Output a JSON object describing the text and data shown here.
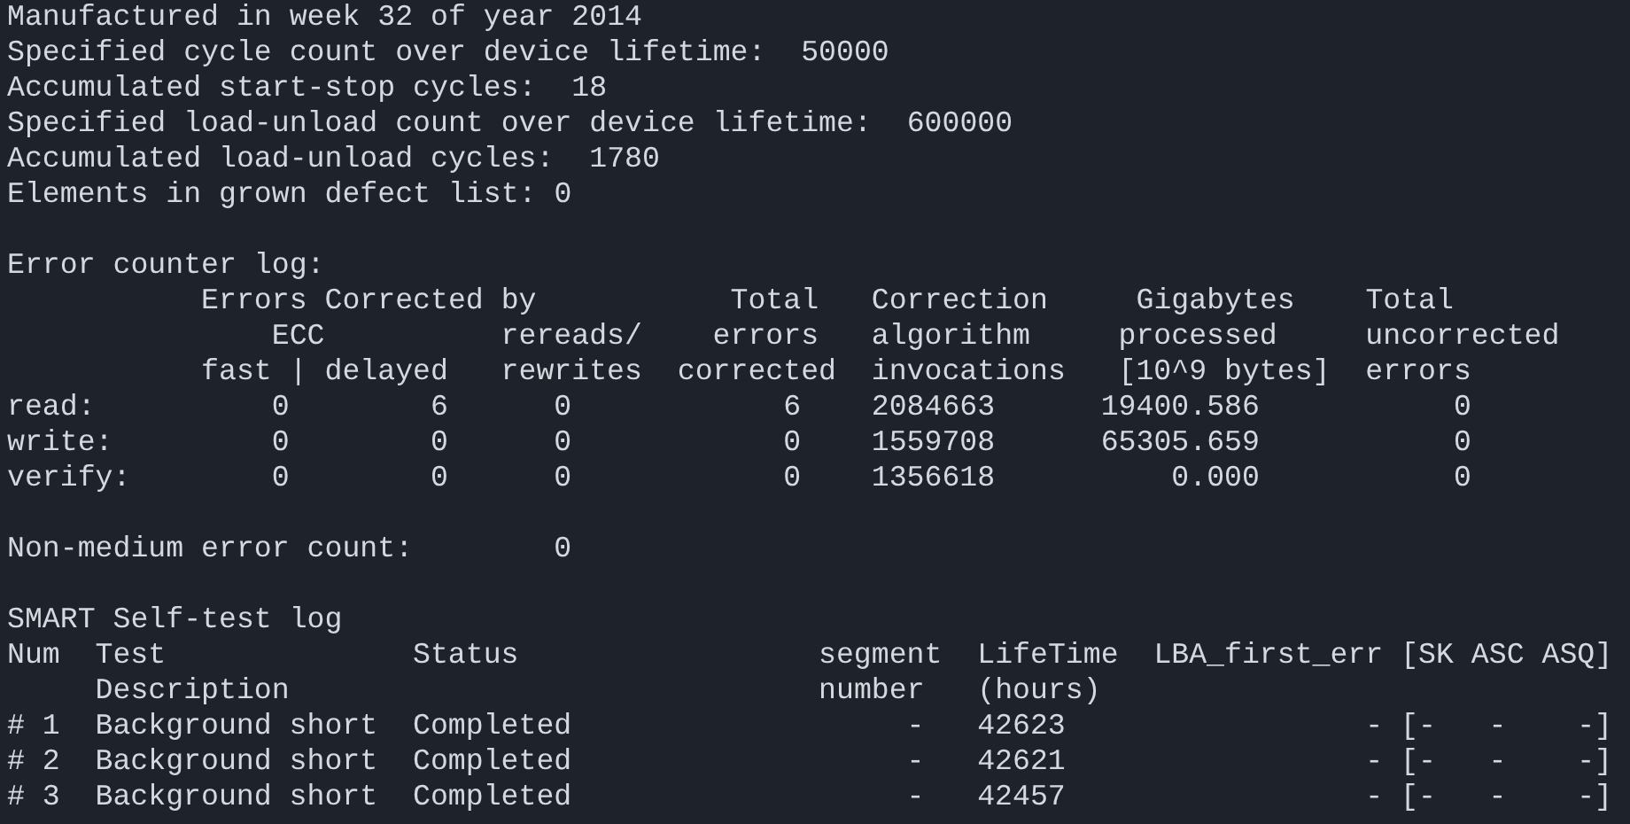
{
  "info_lines": [
    "Manufactured in week 32 of year 2014",
    "Specified cycle count over device lifetime:  50000",
    "Accumulated start-stop cycles:  18",
    "Specified load-unload count over device lifetime:  600000",
    "Accumulated load-unload cycles:  1780",
    "Elements in grown defect list: 0"
  ],
  "error_counter_log": {
    "title": "Error counter log:",
    "header_lines": [
      [
        "Errors Corrected by",
        "Total",
        "Correction",
        "Gigabytes",
        "Total"
      ],
      [
        "ECC",
        "rereads/",
        "errors",
        "algorithm",
        "processed",
        "uncorrected"
      ],
      [
        "fast | delayed",
        "rewrites",
        "corrected",
        "invocations",
        "[10^9 bytes]",
        "errors"
      ]
    ],
    "rows": [
      [
        "read:",
        "0",
        "6",
        "0",
        "6",
        "2084663",
        "19400.586",
        "0"
      ],
      [
        "write:",
        "0",
        "0",
        "0",
        "0",
        "1559708",
        "65305.659",
        "0"
      ],
      [
        "verify:",
        "0",
        "0",
        "0",
        "0",
        "1356618",
        "0.000",
        "0"
      ]
    ]
  },
  "non_medium": {
    "label": "Non-medium error count:",
    "value": "0"
  },
  "self_test_log": {
    "title": "SMART Self-test log",
    "header_lines": [
      [
        "Num",
        "Test",
        "Status",
        "segment",
        "LifeTime",
        "LBA_first_err",
        "[SK ASC ASQ]"
      ],
      [
        "Description",
        "number",
        "(hours)"
      ]
    ],
    "rows": [
      [
        "# 1",
        "Background short",
        "Completed",
        "-",
        "42623",
        "-",
        "[-",
        "-",
        "-]"
      ],
      [
        "# 2",
        "Background short",
        "Completed",
        "-",
        "42621",
        "-",
        "[-",
        "-",
        "-]"
      ],
      [
        "# 3",
        "Background short",
        "Completed",
        "-",
        "42457",
        "-",
        "[-",
        "-",
        "-]"
      ]
    ]
  }
}
